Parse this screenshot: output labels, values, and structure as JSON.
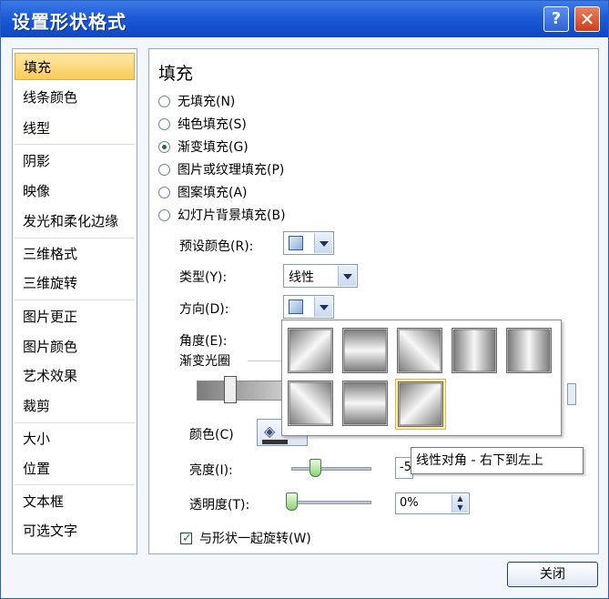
{
  "window": {
    "title": "设置形状格式",
    "help_glyph": "?",
    "close_glyph": "✕"
  },
  "sidebar": {
    "items": [
      {
        "label": "填充",
        "selected": true
      },
      {
        "label": "线条颜色"
      },
      {
        "label": "线型"
      },
      {
        "label": "阴影"
      },
      {
        "label": "映像"
      },
      {
        "label": "发光和柔化边缘"
      },
      {
        "label": "三维格式"
      },
      {
        "label": "三维旋转"
      },
      {
        "label": "图片更正"
      },
      {
        "label": "图片颜色"
      },
      {
        "label": "艺术效果"
      },
      {
        "label": "裁剪"
      },
      {
        "label": "大小"
      },
      {
        "label": "位置"
      },
      {
        "label": "文本框"
      },
      {
        "label": "可选文字"
      }
    ]
  },
  "fill": {
    "heading": "填充",
    "options": [
      {
        "label": "无填充(N)",
        "checked": false
      },
      {
        "label": "纯色填充(S)",
        "checked": false
      },
      {
        "label": "渐变填充(G)",
        "checked": true
      },
      {
        "label": "图片或纹理填充(P)",
        "checked": false
      },
      {
        "label": "图案填充(A)",
        "checked": false
      },
      {
        "label": "幻灯片背景填充(B)",
        "checked": false
      }
    ],
    "preset_label": "预设颜色(R):",
    "type_label": "类型(Y):",
    "type_value": "线性",
    "direction_label": "方向(D):",
    "angle_label": "角度(E):",
    "stops_label": "渐变光圈",
    "color_label": "颜色(C)",
    "brightness_label": "亮度(I):",
    "brightness_value": "-5",
    "brightness_level": 0.3,
    "transparency_label": "透明度(T):",
    "transparency_value": "0%",
    "transparency_level": 0.0,
    "rotate_label": "与形状一起旋转(W)",
    "rotate_checked": true
  },
  "direction_popup": {
    "tiles": [
      "linear-diagonal-topleft",
      "linear-down",
      "linear-diagonal-topright",
      "linear-right",
      "linear-left",
      "linear-diagonal-bottomleft",
      "linear-up",
      "linear-diagonal-bottomright"
    ],
    "highlighted_index": 7,
    "tooltip": "线性对角 - 右下到左上"
  },
  "footer": {
    "close_label": "关闭"
  }
}
